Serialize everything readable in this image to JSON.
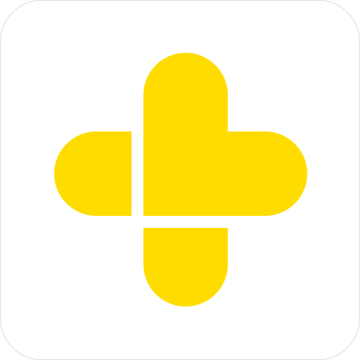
{
  "app_icon": {
    "icon_name": "yellow-cross-logo-icon",
    "colors": {
      "background": "#ffffff",
      "border": "#d9d9d9",
      "logo": "#FFDC00"
    }
  }
}
